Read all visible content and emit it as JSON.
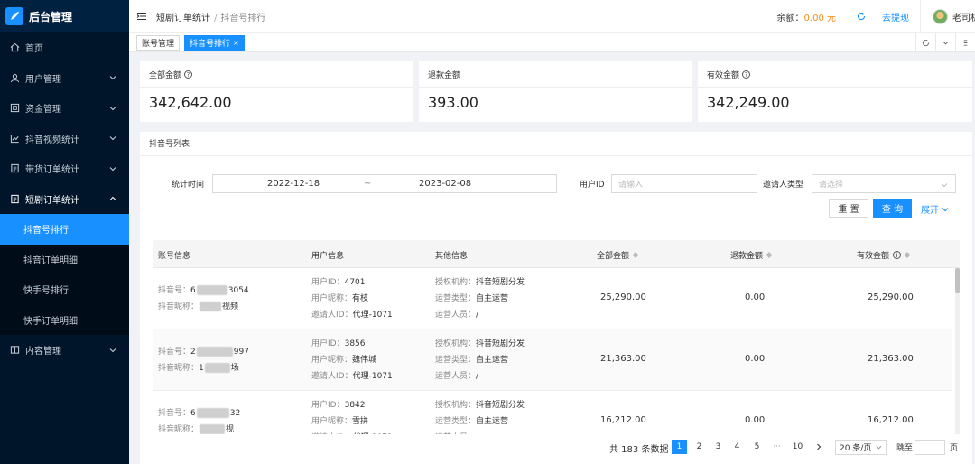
{
  "brand": {
    "title": "后台管理"
  },
  "sidebar": {
    "items": [
      {
        "label": "首页",
        "icon": "home-icon"
      },
      {
        "label": "用户管理",
        "icon": "user-icon"
      },
      {
        "label": "资金管理",
        "icon": "wallet-icon"
      },
      {
        "label": "抖音视频统计",
        "icon": "line-chart-icon"
      },
      {
        "label": "带货订单统计",
        "icon": "file-icon"
      },
      {
        "label": "短剧订单统计",
        "icon": "file-icon"
      },
      {
        "label": "内容管理",
        "icon": "book-icon"
      }
    ],
    "sub_items": [
      "抖音号排行",
      "抖音订单明细",
      "快手号排行",
      "快手订单明细"
    ]
  },
  "header": {
    "breadcrumb_parent": "短剧订单统计",
    "breadcrumb_sep": "/",
    "breadcrumb_current": "抖音号排行",
    "balance_label": "余额：",
    "balance_amount": "0.00",
    "balance_unit": " 元",
    "withdraw": "去提现",
    "username": "老司机"
  },
  "tabs": [
    {
      "label": "账号管理"
    },
    {
      "label": "抖音号排行",
      "close": "×"
    }
  ],
  "stats": [
    {
      "title": "全部金额",
      "value": "342,642.00"
    },
    {
      "title": "退款金额",
      "value": "393.00"
    },
    {
      "title": "有效金额",
      "value": "342,249.00"
    }
  ],
  "list": {
    "title": "抖音号列表",
    "filters": {
      "time_label": "统计时间",
      "date_start": "2022-12-18",
      "date_sep": "~",
      "date_end": "2023-02-08",
      "userid_label": "用户ID",
      "userid_placeholder": "请输入",
      "inviter_label": "邀请人类型",
      "inviter_placeholder": "请选择",
      "reset": "重 置",
      "query": "查 询",
      "expand": "展开"
    },
    "columns": [
      "账号信息",
      "用户信息",
      "其他信息",
      "全部金额",
      "退款金额",
      "有效金额"
    ],
    "labels": {
      "douyin_no": "抖音号：",
      "douyin_nick": "抖音昵称：",
      "user_id": "用户ID：",
      "user_nick": "用户昵称：",
      "inviter_id": "邀请人ID：",
      "auth_org": "授权机构：",
      "op_type": "运营类型：",
      "op_staff": "运营人员："
    },
    "rows": [
      {
        "dy_no_a": "6",
        "dy_no_b": "3054",
        "dy_nick_a": "",
        "dy_nick_b": "视频",
        "user_id": "4701",
        "user_nick": "有枝",
        "inviter_id": "代理-1071",
        "auth_org": "抖音短剧分发",
        "op_type": "自主运营",
        "op_staff": "/",
        "total": "25,290.00",
        "refund": "0.00",
        "valid": "25,290.00"
      },
      {
        "dy_no_a": "2",
        "dy_no_b": "997",
        "dy_nick_a": "1",
        "dy_nick_b": "场",
        "user_id": "3856",
        "user_nick": "魏伟城",
        "inviter_id": "代理-1071",
        "auth_org": "抖音短剧分发",
        "op_type": "自主运营",
        "op_staff": "/",
        "total": "21,363.00",
        "refund": "0.00",
        "valid": "21,363.00"
      },
      {
        "dy_no_a": "6",
        "dy_no_b": "32",
        "dy_nick_a": "",
        "dy_nick_b": "视",
        "user_id": "3842",
        "user_nick": "雪拼",
        "inviter_id": "代理-1071",
        "auth_org": "抖音短剧分发",
        "op_type": "自主运营",
        "op_staff": "/",
        "total": "16,212.00",
        "refund": "0.00",
        "valid": "16,212.00"
      }
    ],
    "pagination": {
      "total_text": "共 183 条数据",
      "pages": [
        "1",
        "2",
        "3",
        "4",
        "5"
      ],
      "ellipsis": "···",
      "last_page": "10",
      "page_size": "20 条/页",
      "jump_label": "跳至",
      "page_suffix": "页"
    }
  },
  "colors": {
    "sidebar_bg": "#001529",
    "accent": "#1890ff",
    "balance": "#fa8c16"
  }
}
